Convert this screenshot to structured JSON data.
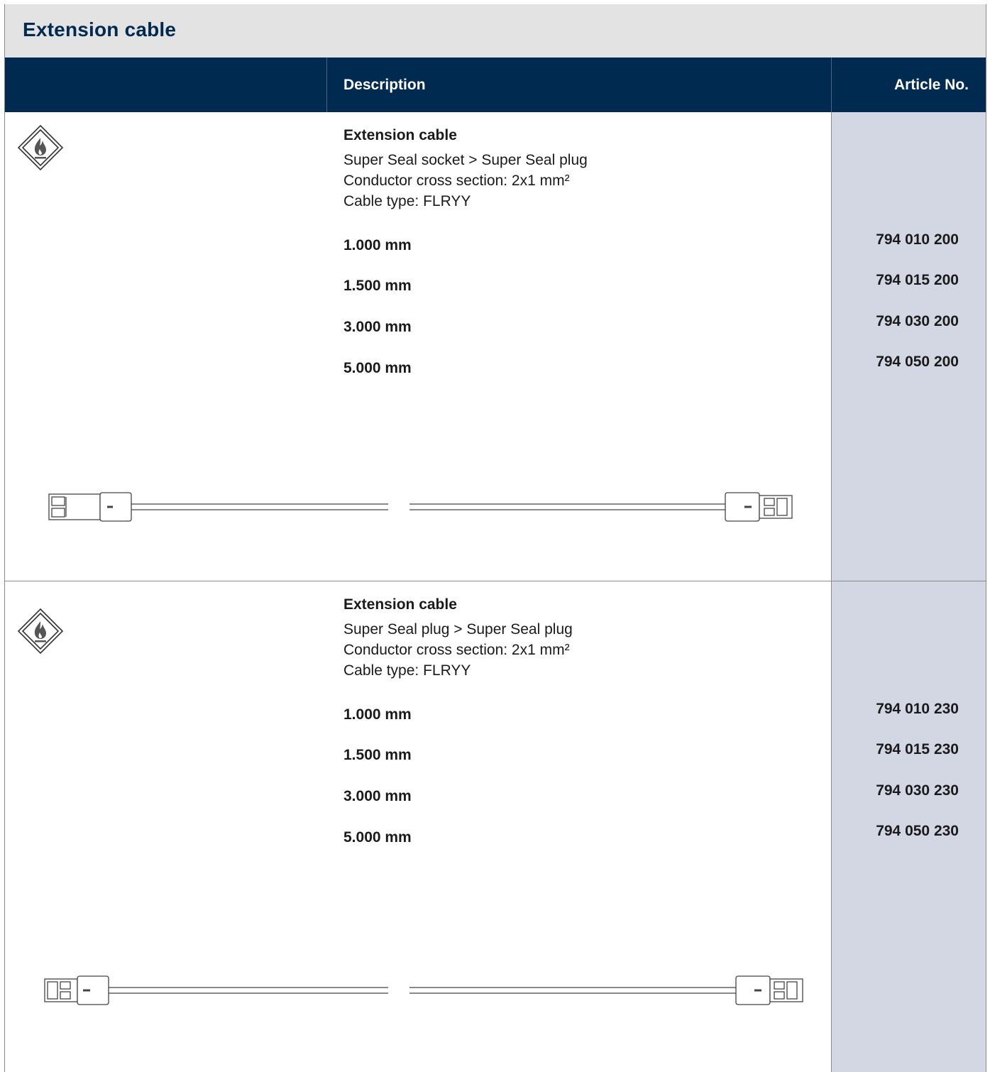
{
  "page_title": "Extension cable",
  "header": {
    "description": "Description",
    "article_no": "Article No."
  },
  "sections": [
    {
      "title": "Extension cable",
      "lines": [
        "Super Seal socket > Super Seal plug",
        "Conductor cross section: 2x1 mm²",
        "Cable type: FLRYY"
      ],
      "lengths": [
        "1.000 mm",
        "1.500 mm",
        "3.000 mm",
        "5.000 mm"
      ],
      "articles": [
        "794 010 200",
        "794 015 200",
        "794 030 200",
        "794 050 200"
      ],
      "icon": "flammable-warning-icon",
      "drawing": "cable-socket-to-plug-drawing"
    },
    {
      "title": "Extension cable",
      "lines": [
        "Super Seal plug > Super Seal plug",
        "Conductor cross section: 2x1 mm²",
        "Cable type: FLRYY"
      ],
      "lengths": [
        "1.000 mm",
        "1.500 mm",
        "3.000 mm",
        "5.000 mm"
      ],
      "articles": [
        "794 010 230",
        "794 015 230",
        "794 030 230",
        "794 050 230"
      ],
      "icon": "flammable-warning-icon",
      "drawing": "cable-plug-to-plug-drawing"
    }
  ],
  "colors": {
    "header_bg": "#002a50",
    "title_bg": "#e3e3e3",
    "article_col_bg": "#d3d6e3"
  }
}
